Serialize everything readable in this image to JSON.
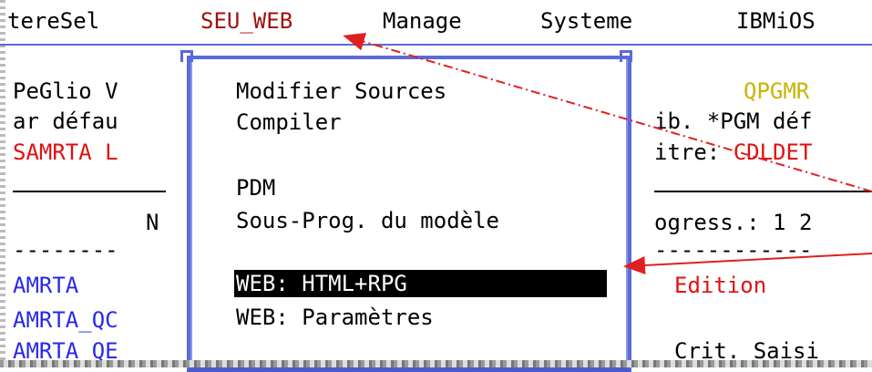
{
  "menubar": {
    "items": [
      "tereSel",
      "SEU_WEB",
      "Manage",
      "Systeme",
      "IBMiOS"
    ]
  },
  "left_panel": {
    "lines": [
      "PeGlio V",
      "ar défau",
      "SAMRTA L"
    ],
    "header_N": "N",
    "dashes": "--------",
    "rows": [
      "AMRTA",
      "AMRTA_QC",
      "AMRTA_QE"
    ]
  },
  "right_panel": {
    "qpgmr": "QPGMR",
    "line2": "ib. *PGM déf",
    "line3_prefix": "itre: ",
    "line3_value": "CDLDET",
    "progress": "ogress.: 1 2",
    "dashes": "------------",
    "edition": "Edition",
    "crit": "Crit. Saisi"
  },
  "popup_menu": {
    "items": [
      "Modifier Sources",
      "Compiler",
      "",
      "PDM",
      "Sous-Prog. du modèle",
      "",
      "WEB: HTML+RPG",
      "WEB: Paramètres"
    ],
    "selected_index": 6
  },
  "colors": {
    "accent_blue": "#2929e6",
    "menu_active": "#a01010",
    "error_red": "#e01010",
    "highlight_yellow": "#c8b400",
    "popup_border": "#5a6bd8",
    "arrow_red": "#e02020"
  }
}
